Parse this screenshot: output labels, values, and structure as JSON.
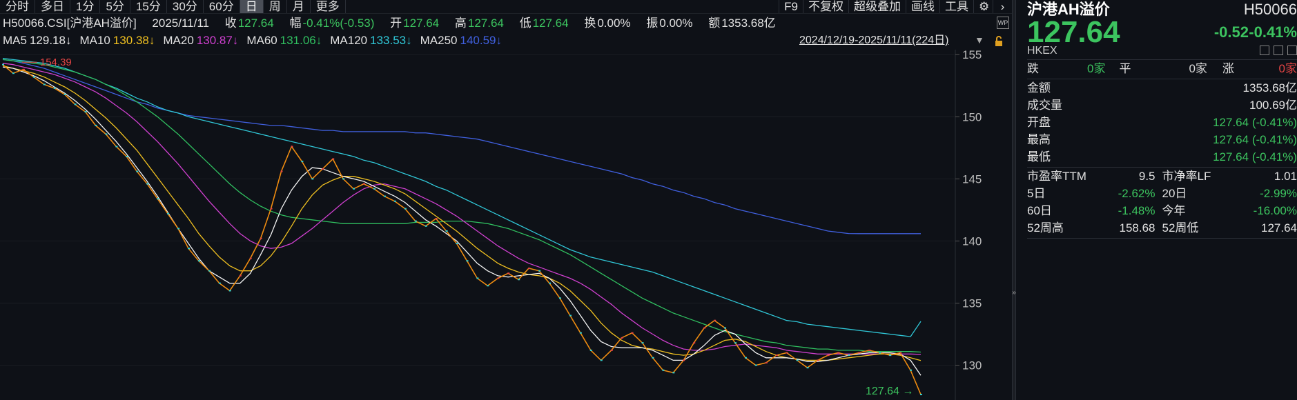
{
  "toolbar": {
    "left": [
      "分时",
      "多日",
      "1分",
      "5分",
      "15分",
      "30分",
      "60分",
      "日",
      "周",
      "月",
      "更多"
    ],
    "active": "日",
    "right": [
      "F9",
      "不复权",
      "超级叠加",
      "画线",
      "工具"
    ]
  },
  "quote": {
    "code_name": "H50066.CSI[沪港AH溢价]",
    "date": "2025/11/11",
    "close_label": "收",
    "close": "127.64",
    "amp_label": "幅",
    "amp": "-0.41%(-0.53)",
    "open_label": "开",
    "open": "127.64",
    "high_label": "高",
    "high": "127.64",
    "low_label": "低",
    "low": "127.64",
    "turnover_label": "换",
    "turnover": "0.00%",
    "swing_label": "振",
    "swing": "0.00%",
    "amount_label": "额",
    "amount": "1353.68亿"
  },
  "ma": [
    {
      "label": "MA5",
      "value": "129.18↓",
      "color": "#e8e8e8",
      "line": "#f5f5f5"
    },
    {
      "label": "MA10",
      "value": "130.38↓",
      "color": "#f0c020",
      "line": "#f0c020"
    },
    {
      "label": "MA20",
      "value": "130.87↓",
      "color": "#d040d0",
      "line": "#d040d0"
    },
    {
      "label": "MA60",
      "value": "131.06↓",
      "color": "#30c060",
      "line": "#30c060"
    },
    {
      "label": "MA120",
      "value": "133.53↓",
      "color": "#30c8d8",
      "line": "#30c8d8"
    },
    {
      "label": "MA250",
      "value": "140.59↓",
      "color": "#4060e0",
      "line": "#4060e0"
    }
  ],
  "range_label": "2024/12/19-2025/11/11(224日)",
  "chart_data": {
    "type": "line",
    "y_ticks": [
      155,
      150,
      145,
      140,
      135,
      130
    ],
    "ylim": [
      127.2,
      155.4
    ],
    "max_label": "154.39",
    "last_label": "127.64",
    "kline": [
      154.2,
      153.5,
      153.8,
      153.2,
      152.6,
      152.3,
      151.8,
      151.0,
      150.4,
      149.3,
      148.6,
      147.6,
      146.8,
      145.6,
      144.6,
      143.4,
      142.2,
      141.0,
      139.4,
      138.4,
      137.6,
      136.6,
      136.0,
      137.2,
      138.6,
      140.2,
      142.6,
      145.6,
      147.6,
      146.4,
      145.0,
      145.8,
      146.6,
      145.0,
      144.2,
      144.6,
      144.2,
      143.6,
      143.2,
      142.6,
      141.6,
      141.2,
      141.8,
      140.8,
      139.8,
      138.4,
      137.0,
      136.4,
      137.0,
      137.4,
      136.9,
      137.8,
      137.6,
      136.6,
      135.4,
      134.0,
      132.6,
      131.2,
      130.4,
      131.2,
      132.2,
      132.6,
      131.8,
      130.6,
      129.6,
      129.4,
      130.4,
      131.8,
      133.0,
      133.6,
      133.0,
      131.8,
      130.6,
      130.0,
      130.2,
      130.8,
      131.0,
      130.4,
      129.8,
      130.4,
      130.8,
      131.0,
      130.8,
      131.0,
      131.2,
      131.0,
      130.8,
      131.0,
      129.6,
      127.64
    ],
    "ma5": [
      154.0,
      153.9,
      153.6,
      153.3,
      152.9,
      152.4,
      151.9,
      151.3,
      150.6,
      149.8,
      148.9,
      148.0,
      147.0,
      145.9,
      144.8,
      143.6,
      142.3,
      141.0,
      139.8,
      138.6,
      137.6,
      137.1,
      136.6,
      136.6,
      137.4,
      138.9,
      140.5,
      142.6,
      144.1,
      145.2,
      145.9,
      145.8,
      145.5,
      145.2,
      145.0,
      144.8,
      144.4,
      144.0,
      143.6,
      143.1,
      142.4,
      141.7,
      141.2,
      140.6,
      140.0,
      139.1,
      138.2,
      137.6,
      137.2,
      137.1,
      137.2,
      137.3,
      137.4,
      137.0,
      136.2,
      135.2,
      134.0,
      132.8,
      131.9,
      131.5,
      131.4,
      131.4,
      131.4,
      131.2,
      130.8,
      130.4,
      130.4,
      130.9,
      131.6,
      132.4,
      132.8,
      132.5,
      131.7,
      131.0,
      130.6,
      130.6,
      130.6,
      130.5,
      130.3,
      130.3,
      130.4,
      130.6,
      130.8,
      130.9,
      131.0,
      131.0,
      131.0,
      130.9,
      130.4,
      129.18
    ],
    "ma10": [
      154.1,
      153.9,
      153.7,
      153.5,
      153.2,
      152.8,
      152.4,
      151.9,
      151.3,
      150.6,
      149.9,
      149.1,
      148.2,
      147.3,
      146.2,
      145.1,
      144.0,
      142.9,
      141.8,
      140.6,
      139.6,
      138.7,
      138.0,
      137.6,
      137.6,
      138.0,
      138.8,
      139.9,
      141.2,
      142.6,
      143.7,
      144.5,
      144.9,
      145.2,
      145.2,
      145.0,
      144.8,
      144.5,
      144.2,
      143.8,
      143.2,
      142.6,
      142.0,
      141.4,
      140.8,
      140.1,
      139.4,
      138.8,
      138.2,
      137.8,
      137.5,
      137.3,
      137.2,
      137.0,
      136.6,
      136.0,
      135.2,
      134.4,
      133.4,
      132.6,
      132.0,
      131.6,
      131.4,
      131.3,
      131.1,
      130.9,
      130.8,
      130.9,
      131.2,
      131.6,
      132.0,
      132.1,
      131.9,
      131.5,
      131.1,
      130.8,
      130.6,
      130.5,
      130.4,
      130.4,
      130.4,
      130.5,
      130.6,
      130.7,
      130.8,
      130.9,
      130.9,
      130.8,
      130.6,
      130.38
    ],
    "ma20": [
      154.3,
      154.2,
      154.0,
      153.8,
      153.6,
      153.4,
      153.1,
      152.8,
      152.4,
      152.0,
      151.5,
      150.9,
      150.3,
      149.6,
      148.8,
      148.0,
      147.1,
      146.2,
      145.2,
      144.2,
      143.2,
      142.3,
      141.4,
      140.6,
      140.0,
      139.6,
      139.4,
      139.5,
      139.8,
      140.4,
      141.0,
      141.7,
      142.4,
      143.1,
      143.7,
      144.2,
      144.5,
      144.6,
      144.4,
      144.2,
      143.8,
      143.4,
      143.0,
      142.5,
      142.0,
      141.4,
      140.8,
      140.2,
      139.6,
      139.1,
      138.6,
      138.2,
      137.9,
      137.6,
      137.3,
      137.0,
      136.6,
      136.1,
      135.5,
      134.9,
      134.2,
      133.6,
      133.0,
      132.5,
      132.0,
      131.6,
      131.3,
      131.2,
      131.2,
      131.3,
      131.5,
      131.6,
      131.7,
      131.6,
      131.5,
      131.4,
      131.2,
      131.1,
      131.0,
      130.9,
      130.9,
      130.9,
      130.9,
      130.9,
      130.9,
      130.9,
      130.9,
      130.9,
      130.9,
      130.87
    ],
    "ma60": [
      154.6,
      154.5,
      154.4,
      154.3,
      154.2,
      154.0,
      153.8,
      153.6,
      153.3,
      153.0,
      152.6,
      152.2,
      151.7,
      151.2,
      150.6,
      150.0,
      149.3,
      148.6,
      147.8,
      147.0,
      146.2,
      145.4,
      144.6,
      143.9,
      143.3,
      142.8,
      142.4,
      142.1,
      141.9,
      141.8,
      141.7,
      141.6,
      141.5,
      141.4,
      141.4,
      141.4,
      141.4,
      141.4,
      141.4,
      141.4,
      141.5,
      141.5,
      141.5,
      141.6,
      141.6,
      141.6,
      141.5,
      141.4,
      141.2,
      141.0,
      140.7,
      140.4,
      140.1,
      139.7,
      139.3,
      138.9,
      138.4,
      137.9,
      137.4,
      136.9,
      136.4,
      135.9,
      135.4,
      135.0,
      134.6,
      134.2,
      133.9,
      133.6,
      133.3,
      133.0,
      132.7,
      132.5,
      132.3,
      132.1,
      131.9,
      131.8,
      131.6,
      131.5,
      131.4,
      131.3,
      131.3,
      131.2,
      131.2,
      131.2,
      131.1,
      131.1,
      131.1,
      131.1,
      131.1,
      131.06
    ],
    "ma120": [
      154.7,
      154.6,
      154.5,
      154.4,
      154.3,
      154.1,
      153.9,
      153.6,
      153.3,
      153.0,
      152.6,
      152.3,
      151.9,
      151.5,
      151.2,
      150.8,
      150.5,
      150.3,
      150.0,
      149.8,
      149.6,
      149.4,
      149.2,
      149.0,
      148.8,
      148.6,
      148.4,
      148.2,
      148.0,
      147.8,
      147.6,
      147.4,
      147.2,
      147.0,
      146.8,
      146.5,
      146.3,
      146.0,
      145.7,
      145.4,
      145.1,
      144.8,
      144.4,
      144.1,
      143.7,
      143.3,
      142.9,
      142.5,
      142.1,
      141.7,
      141.3,
      140.9,
      140.5,
      140.1,
      139.7,
      139.3,
      139.0,
      138.7,
      138.5,
      138.3,
      138.1,
      137.9,
      137.7,
      137.5,
      137.2,
      136.9,
      136.6,
      136.3,
      136.0,
      135.7,
      135.4,
      135.1,
      134.8,
      134.5,
      134.2,
      133.9,
      133.6,
      133.5,
      133.3,
      133.2,
      133.1,
      133.0,
      132.9,
      132.8,
      132.7,
      132.6,
      132.5,
      132.4,
      132.3,
      133.53
    ],
    "ma250": [
      154.6,
      154.5,
      154.3,
      154.1,
      153.9,
      153.6,
      153.3,
      153.0,
      152.7,
      152.4,
      152.1,
      151.8,
      151.5,
      151.2,
      151.0,
      150.7,
      150.5,
      150.3,
      150.1,
      150.0,
      149.9,
      149.8,
      149.7,
      149.6,
      149.5,
      149.4,
      149.3,
      149.3,
      149.2,
      149.1,
      149.0,
      148.9,
      148.9,
      148.8,
      148.8,
      148.8,
      148.8,
      148.8,
      148.8,
      148.8,
      148.7,
      148.7,
      148.6,
      148.5,
      148.4,
      148.3,
      148.2,
      148.0,
      147.8,
      147.6,
      147.4,
      147.2,
      147.0,
      146.8,
      146.6,
      146.4,
      146.2,
      146.0,
      145.8,
      145.6,
      145.4,
      145.1,
      144.9,
      144.6,
      144.4,
      144.1,
      143.9,
      143.6,
      143.4,
      143.1,
      142.9,
      142.6,
      142.4,
      142.2,
      142.0,
      141.8,
      141.6,
      141.4,
      141.2,
      141.0,
      140.8,
      140.7,
      140.6,
      140.59,
      140.59,
      140.59,
      140.59,
      140.59,
      140.59,
      140.59
    ]
  },
  "panel": {
    "title": "沪港AH溢价",
    "code": "H50066",
    "price": "127.64",
    "change": "-0.52",
    "change_pct": "-0.41%",
    "exchange": "HKEX",
    "breadth": {
      "down_label": "跌",
      "down": "0家",
      "flat_label": "平",
      "flat": "0家",
      "up_label": "涨",
      "up": "0家"
    },
    "rows": [
      {
        "label": "金额",
        "value": "1353.68亿",
        "color": "#e2e2e2"
      },
      {
        "label": "成交量",
        "value": "100.69亿",
        "color": "#e2e2e2"
      },
      {
        "label": "开盘",
        "value": "127.64 (-0.41%)",
        "color": "#3cc45f"
      },
      {
        "label": "最高",
        "value": "127.64 (-0.41%)",
        "color": "#3cc45f"
      },
      {
        "label": "最低",
        "value": "127.64 (-0.41%)",
        "color": "#3cc45f"
      }
    ],
    "pairs": [
      [
        {
          "label": "市盈率TTM",
          "value": "9.5",
          "color": "#e2e2e2"
        },
        {
          "label": "市净率LF",
          "value": "1.01",
          "color": "#e2e2e2"
        }
      ],
      [
        {
          "label": "5日",
          "value": "-2.62%",
          "color": "#3cc45f"
        },
        {
          "label": "20日",
          "value": "-2.99%",
          "color": "#3cc45f"
        }
      ],
      [
        {
          "label": "60日",
          "value": "-1.48%",
          "color": "#3cc45f"
        },
        {
          "label": "今年",
          "value": "-16.00%",
          "color": "#3cc45f"
        }
      ],
      [
        {
          "label": "52周高",
          "value": "158.68",
          "color": "#e2e2e2"
        },
        {
          "label": "52周低",
          "value": "127.64",
          "color": "#e2e2e2"
        }
      ]
    ]
  }
}
